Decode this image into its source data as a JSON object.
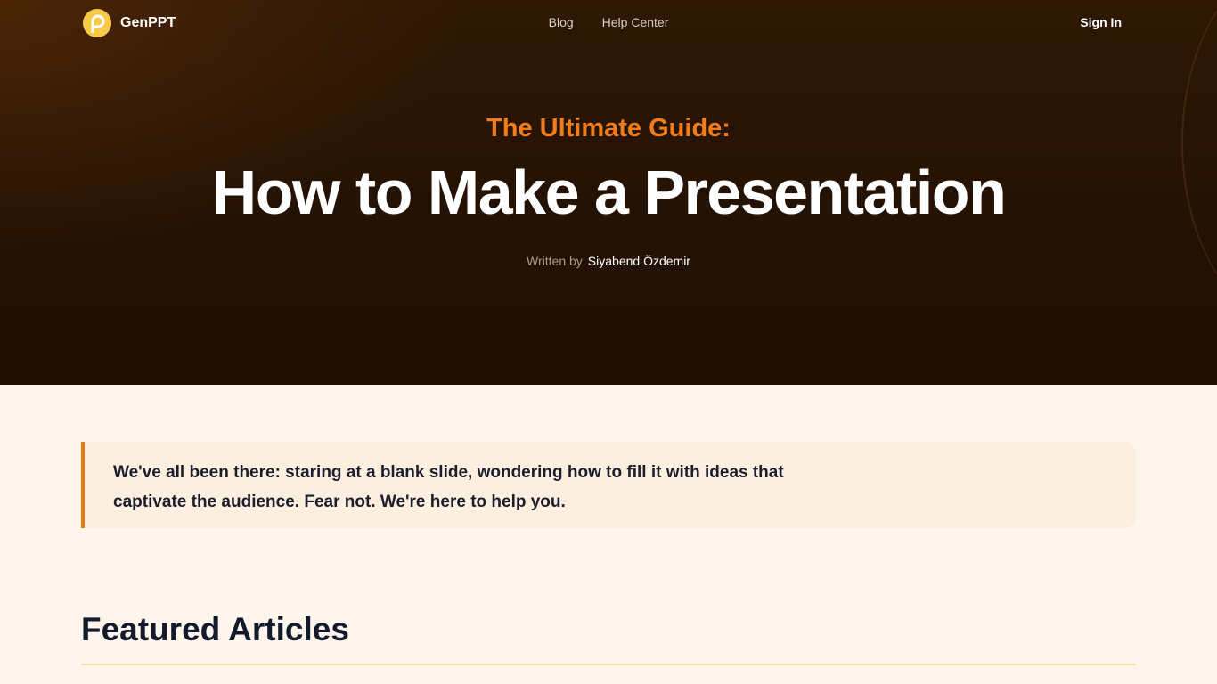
{
  "nav": {
    "brand": "GenPPT",
    "links": [
      "Blog",
      "Help Center"
    ],
    "sign_in": "Sign In"
  },
  "hero": {
    "kicker": "The Ultimate Guide:",
    "title": "How to Make a Presentation",
    "byline_prefix": "Written by",
    "author": "Siyabend Özdemir"
  },
  "intro": {
    "text": "We've all been there: staring at a blank slide, wondering how to fill it with ideas that captivate the audience. Fear not. We're here to help you."
  },
  "featured": {
    "title": "Featured Articles"
  },
  "colors": {
    "accent": "#e77a16",
    "logo": "#f7c948",
    "hero_bg": "#241204",
    "page_bg": "#fef6ec"
  }
}
